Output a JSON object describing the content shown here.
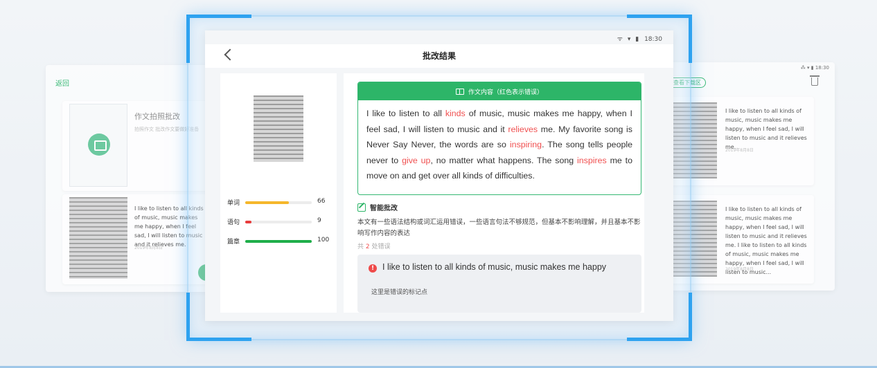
{
  "left_panel": {
    "back_label": "返回",
    "photo_card": {
      "title": "作文拍照批改",
      "subtitle": "拍照作文 批改作文要做好准备"
    },
    "history_card": {
      "snippet": "I like to listen to all kinds of music, music makes me happy, when I feel sad, I will listen to music and it relieves me.",
      "date": "2019年8月8日"
    }
  },
  "right_panel": {
    "status": "⁂ ▾ ▮ 18:30",
    "tag": "查看下载区",
    "cards": [
      {
        "snippet": "I like to listen to all kinds of music, music makes me happy, when I feel sad, I will listen to music and it relieves me.",
        "date": "2019年8月8日"
      },
      {
        "snippet": "I like to listen to all kinds of music, music makes me happy, when I feel sad, I will listen to music and it relieves me. I like to listen to all kinds of music, music makes me happy, when I feel sad, I will listen to music...",
        "date": "2019年8月8日"
      }
    ]
  },
  "screen": {
    "status_time": "18:30",
    "status_icons": "ᯤ ▾ ▮",
    "title": "批改结果",
    "stats": [
      {
        "label": "单词",
        "value": 66,
        "color": "#f5b72b"
      },
      {
        "label": "语句",
        "value": 9,
        "color": "#e83c3c"
      },
      {
        "label": "篇章",
        "value": 100,
        "color": "#1fae4a"
      }
    ],
    "essay": {
      "header": "作文内容（红色表示错误）",
      "segments": [
        {
          "text": "I like to listen to all ",
          "error": false
        },
        {
          "text": "kinds",
          "error": true
        },
        {
          "text": " of music, music makes me happy, when I feel sad, I will listen to music and it ",
          "error": false
        },
        {
          "text": "relieves",
          "error": true
        },
        {
          "text": " me. My favorite song is Never Say Never, the words are so ",
          "error": false
        },
        {
          "text": "inspiring",
          "error": true
        },
        {
          "text": ". The song tells people never to ",
          "error": false
        },
        {
          "text": "give up",
          "error": true
        },
        {
          "text": ", no matter what happens. The song ",
          "error": false
        },
        {
          "text": "inspires",
          "error": true
        },
        {
          "text": " me to move on and get over all kinds of difficulties.",
          "error": false
        }
      ]
    },
    "smart_review": {
      "title": "智能批改",
      "text": "本文有一些语法结构或词汇运用错误，一些语言句法不够规范，但基本不影响理解，并且基本不影响写作内容的表达",
      "count_prefix": "共",
      "count": "2",
      "count_suffix": "处错误"
    },
    "error_item": {
      "icon": "!",
      "sentence": "I like to listen to all kinds of music, music makes me happy",
      "hint": "这里是错误的标记点"
    }
  }
}
